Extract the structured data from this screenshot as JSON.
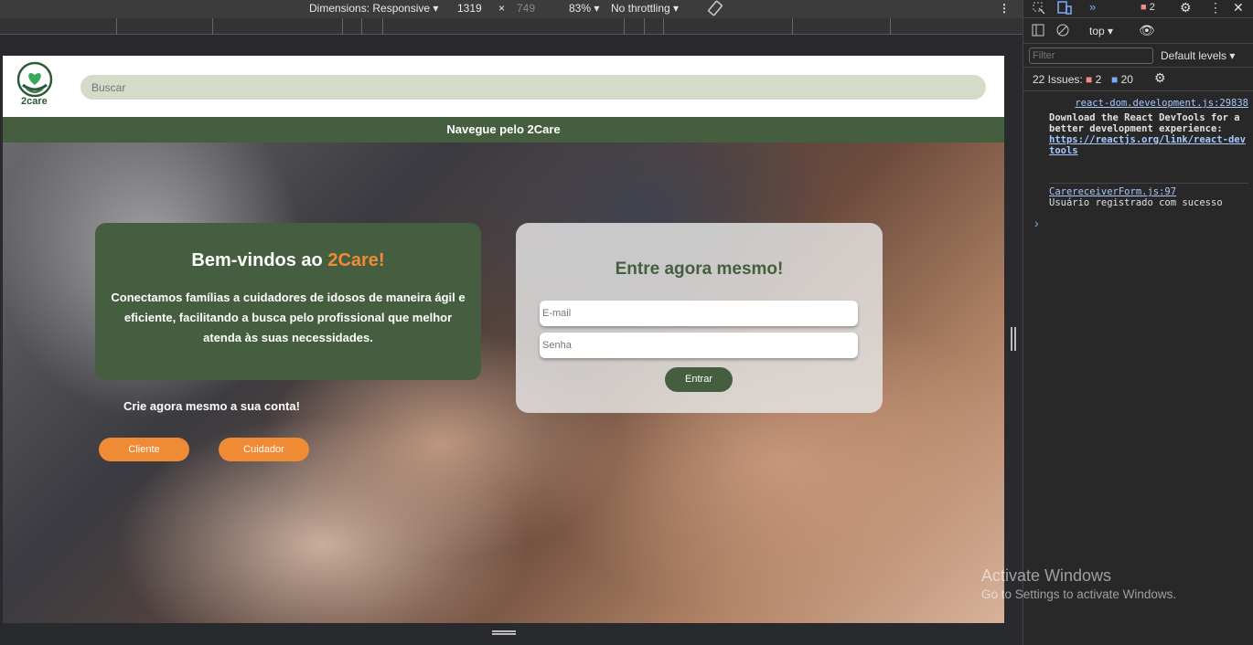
{
  "devbar": {
    "dimensions_label": "Dimensions: Responsive ▾",
    "width": "1319",
    "times": "×",
    "height_placeholder": "749",
    "zoom": "83% ▾",
    "throttling": "No throttling ▾"
  },
  "header": {
    "logo_text": "2care",
    "search_placeholder": "Buscar"
  },
  "nav": {
    "label": "Navegue pelo 2Care"
  },
  "welcome": {
    "title_prefix": "Bem-vindos ao ",
    "title_brand": "2Care!",
    "body": "Conectamos famílias a cuidadores de idosos de maneira ágil e eficiente, facilitando a busca pelo profissional que melhor atenda às suas necessidades."
  },
  "signup": {
    "prompt": "Crie agora mesmo a sua conta!",
    "client_label": "Cliente",
    "caregiver_label": "Cuidador"
  },
  "login": {
    "title": "Entre agora mesmo!",
    "email_placeholder": "E-mail",
    "password_placeholder": "Senha",
    "submit_label": "Entrar"
  },
  "devtools": {
    "issue_count_badge": "2",
    "context": "top ▾",
    "filter_placeholder": "Filter",
    "levels": "Default levels ▾",
    "issues_label": "22 Issues:",
    "issues_errors": "2",
    "issues_info": "20",
    "log1_source": "react-dom.development.js:29838",
    "log1_text": "Download the React DevTools for a better development experience:",
    "log1_link": "https://reactjs.org/link/react-devtools",
    "log2_prefix": "Usuário registrado com sucesso",
    "log2_source": "CarereceiverForm.js:97",
    "prompt": "›"
  },
  "watermark": {
    "title": "Activate Windows",
    "subtitle": "Go to Settings to activate Windows."
  },
  "colors": {
    "brand_green": "#465e40",
    "accent_orange": "#ef8a35",
    "search_bg": "#d3dcc8"
  }
}
